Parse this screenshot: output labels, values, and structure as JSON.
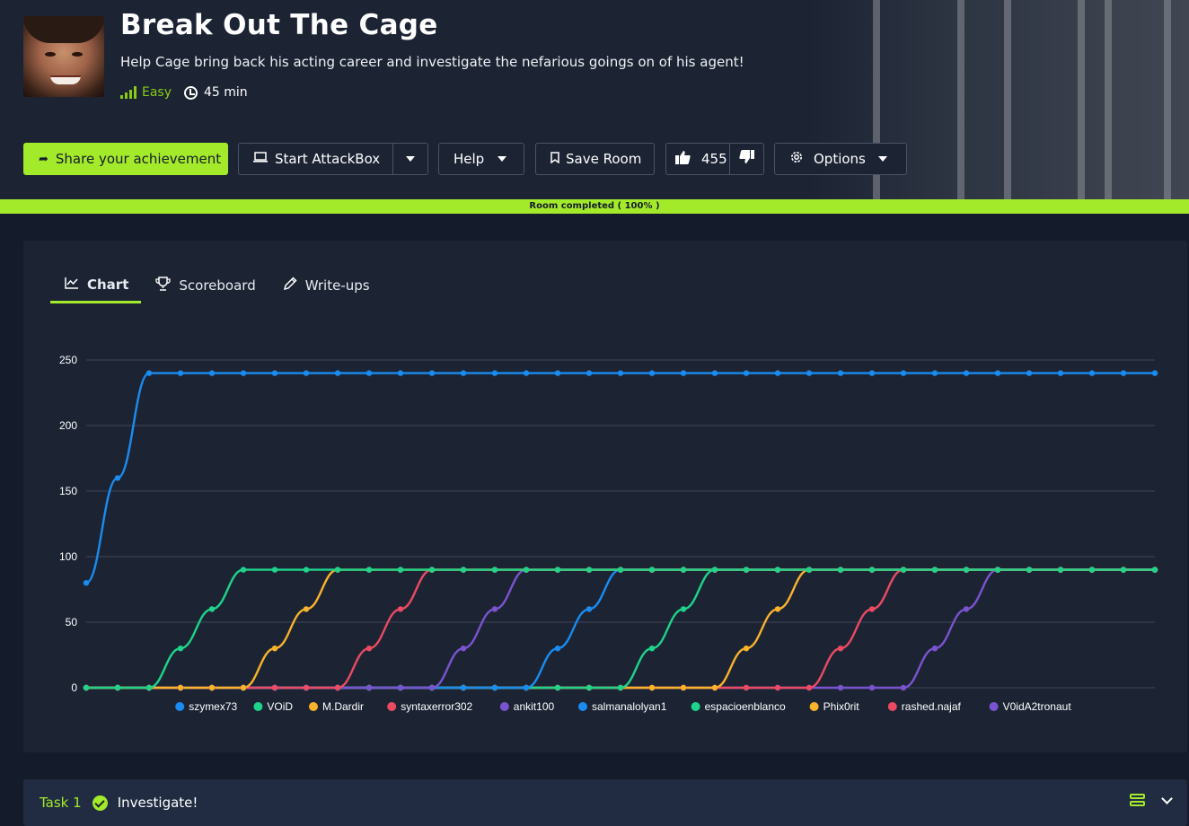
{
  "room": {
    "title": "Break Out The Cage",
    "description": "Help Cage bring back his acting career and investigate the nefarious goings on of his agent!",
    "difficulty": "Easy",
    "duration": "45 min",
    "avatar_icon": "nicolas-cage-avatar"
  },
  "actions": {
    "share_label": "Share your achievement",
    "attackbox_label": "Start AttackBox",
    "help_label": "Help",
    "save_label": "Save Room",
    "likes": "455",
    "options_label": "Options"
  },
  "progress": {
    "label": "Room completed ( 100% )",
    "percent": 100
  },
  "tabs": [
    {
      "label": "Chart",
      "icon": "chart-line-icon",
      "active": true
    },
    {
      "label": "Scoreboard",
      "icon": "trophy-icon",
      "active": false
    },
    {
      "label": "Write-ups",
      "icon": "pencil-icon",
      "active": false
    }
  ],
  "colors": {
    "accent": "#a3ea2a",
    "background": "#141c2b",
    "card": "#1c2434"
  },
  "chart_data": {
    "type": "line",
    "ylim": [
      0,
      250
    ],
    "yticks": [
      0,
      50,
      100,
      150,
      200,
      250
    ],
    "grid": true,
    "legend_position": "bottom",
    "num_points": 35,
    "series": [
      {
        "name": "szymex73",
        "color": "#1a8cf0",
        "values": [
          80,
          160,
          240,
          240,
          240,
          240,
          240,
          240,
          240,
          240,
          240,
          240,
          240,
          240,
          240,
          240,
          240,
          240,
          240,
          240,
          240,
          240,
          240,
          240,
          240,
          240,
          240,
          240,
          240,
          240,
          240,
          240,
          240,
          240,
          240
        ]
      },
      {
        "name": "VOiD",
        "color": "#1ed48a",
        "values": [
          0,
          0,
          0,
          30,
          60,
          90,
          90,
          90,
          90,
          90,
          90,
          90,
          90,
          90,
          90,
          90,
          90,
          90,
          90,
          90,
          90,
          90,
          90,
          90,
          90,
          90,
          90,
          90,
          90,
          90,
          90,
          90,
          90,
          90,
          90
        ]
      },
      {
        "name": "M.Dardir",
        "color": "#f9b32a",
        "values": [
          0,
          0,
          0,
          0,
          0,
          0,
          30,
          60,
          90,
          90,
          90,
          90,
          90,
          90,
          90,
          90,
          90,
          90,
          90,
          90,
          90,
          90,
          90,
          90,
          90,
          90,
          90,
          90,
          90,
          90,
          90,
          90,
          90,
          90,
          90
        ]
      },
      {
        "name": "syntaxerror302",
        "color": "#ec4a63",
        "values": [
          0,
          0,
          0,
          0,
          0,
          0,
          0,
          0,
          0,
          30,
          60,
          90,
          90,
          90,
          90,
          90,
          90,
          90,
          90,
          90,
          90,
          90,
          90,
          90,
          90,
          90,
          90,
          90,
          90,
          90,
          90,
          90,
          90,
          90,
          90
        ]
      },
      {
        "name": "ankit100",
        "color": "#7a54d0",
        "values": [
          0,
          0,
          0,
          0,
          0,
          0,
          0,
          0,
          0,
          0,
          0,
          0,
          30,
          60,
          90,
          90,
          90,
          90,
          90,
          90,
          90,
          90,
          90,
          90,
          90,
          90,
          90,
          90,
          90,
          90,
          90,
          90,
          90,
          90,
          90
        ]
      },
      {
        "name": "salmanalolyan1",
        "color": "#1a8cf0",
        "values": [
          0,
          0,
          0,
          0,
          0,
          0,
          0,
          0,
          0,
          0,
          0,
          0,
          0,
          0,
          0,
          30,
          60,
          90,
          90,
          90,
          90,
          90,
          90,
          90,
          90,
          90,
          90,
          90,
          90,
          90,
          90,
          90,
          90,
          90,
          90
        ]
      },
      {
        "name": "espacioenblanco",
        "color": "#1ed48a",
        "values": [
          0,
          0,
          0,
          0,
          0,
          0,
          0,
          0,
          0,
          0,
          0,
          0,
          0,
          0,
          0,
          0,
          0,
          0,
          30,
          60,
          90,
          90,
          90,
          90,
          90,
          90,
          90,
          90,
          90,
          90,
          90,
          90,
          90,
          90,
          90
        ]
      },
      {
        "name": "Phix0rit",
        "color": "#f9b32a",
        "values": [
          0,
          0,
          0,
          0,
          0,
          0,
          0,
          0,
          0,
          0,
          0,
          0,
          0,
          0,
          0,
          0,
          0,
          0,
          0,
          0,
          0,
          30,
          60,
          90,
          90,
          90,
          90,
          90,
          90,
          90,
          90,
          90,
          90,
          90,
          90
        ]
      },
      {
        "name": "rashed.najaf",
        "color": "#ec4a63",
        "values": [
          0,
          0,
          0,
          0,
          0,
          0,
          0,
          0,
          0,
          0,
          0,
          0,
          0,
          0,
          0,
          0,
          0,
          0,
          0,
          0,
          0,
          0,
          0,
          0,
          30,
          60,
          90,
          90,
          90,
          90,
          90,
          90,
          90,
          90,
          90
        ]
      },
      {
        "name": "V0idA2tronaut",
        "color": "#7a54d0",
        "values": [
          0,
          0,
          0,
          0,
          0,
          0,
          0,
          0,
          0,
          0,
          0,
          0,
          0,
          0,
          0,
          0,
          0,
          0,
          0,
          0,
          0,
          0,
          0,
          0,
          0,
          0,
          0,
          30,
          60,
          90,
          90,
          90,
          90,
          90,
          90
        ]
      }
    ]
  },
  "task": {
    "number": "Task 1",
    "title": "Investigate!"
  }
}
